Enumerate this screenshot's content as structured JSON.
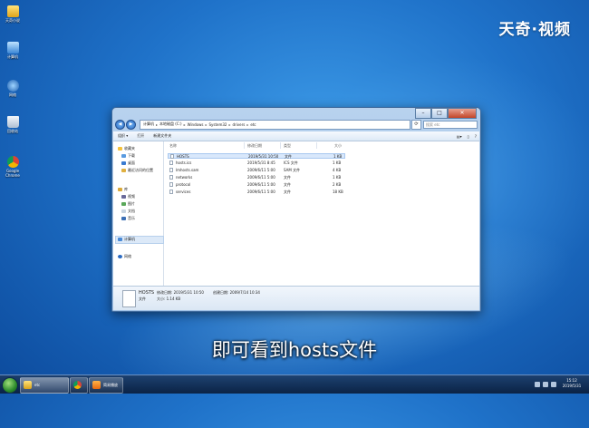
{
  "watermark": "天奇·视频",
  "subtitle": "即可看到hosts文件",
  "desktop_icons": [
    {
      "label": "天奇小说"
    },
    {
      "label": "计算机"
    },
    {
      "label": "网络"
    },
    {
      "label": "回收站"
    },
    {
      "label": "Google Chrome"
    }
  ],
  "window": {
    "address": [
      "计算机",
      "本地磁盘 (C:)",
      "Windows",
      "System32",
      "drivers",
      "etc"
    ],
    "search_placeholder": "搜索 etc",
    "toolbar": {
      "organize": "组织 ▾",
      "open": "打开",
      "new_folder": "新建文件夹"
    },
    "nav": {
      "favorites": "收藏夹",
      "downloads": "下载",
      "desktop": "桌面",
      "recent": "最近访问的位置",
      "libraries": "库",
      "videos": "视频",
      "pictures": "图片",
      "documents": "文档",
      "music": "音乐",
      "computer": "计算机",
      "network": "网络"
    },
    "columns": {
      "name": "名称",
      "date": "修改日期",
      "type": "类型",
      "size": "大小"
    },
    "files": [
      {
        "name": "HOSTS",
        "date": "2019/5/31 10:50",
        "type": "文件",
        "size": "1 KB"
      },
      {
        "name": "hosts.ics",
        "date": "2019/5/31 8:45",
        "type": "ICS 文件",
        "size": "1 KB"
      },
      {
        "name": "lmhosts.sam",
        "date": "2009/6/11 5:00",
        "type": "SAM 文件",
        "size": "4 KB"
      },
      {
        "name": "networks",
        "date": "2009/6/11 5:00",
        "type": "文件",
        "size": "1 KB"
      },
      {
        "name": "protocol",
        "date": "2009/6/11 5:00",
        "type": "文件",
        "size": "2 KB"
      },
      {
        "name": "services",
        "date": "2009/6/11 5:00",
        "type": "文件",
        "size": "18 KB"
      }
    ],
    "details": {
      "name": "HOSTS",
      "modified_label": "修改日期: 2019/5/31 10:50",
      "created_label": "创建日期: 2009/7/14 10:34",
      "type": "文件",
      "size_label": "大小: 1.14 KB"
    }
  },
  "taskbar": {
    "items": [
      {
        "label": "etc"
      },
      {
        "label": ""
      },
      {
        "label": "简易播放"
      }
    ],
    "clock_time": "15:12",
    "clock_date": "2019/5/31"
  },
  "colors": {
    "desktop": "#1f72c9",
    "accent": "#3d9be8",
    "selection": "#d9e8fb"
  }
}
